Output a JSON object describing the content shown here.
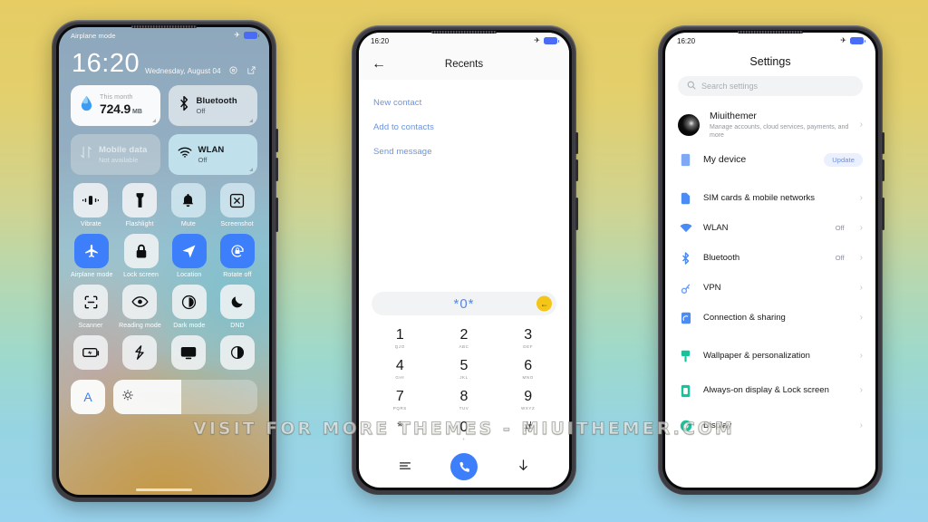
{
  "background": {
    "top_color": "#e6cc63",
    "bottom_color": "#9ad3ee"
  },
  "watermark": {
    "text": "VISIT FOR MORE THEMES - MIUITHEMER.COM"
  },
  "accent": {
    "blue": "#3d7efb",
    "link_blue": "#6a92e0",
    "yellow": "#f5c518",
    "green": "#19c39a"
  },
  "phone1": {
    "name": "control-center",
    "statusbar": {
      "left_label": "Airplane mode",
      "airplane_icon": "airplane-icon",
      "battery_icon": "battery-icon"
    },
    "clock": {
      "time": "16:20",
      "date": "Wednesday, August 04"
    },
    "header_icons": [
      "settings-gear-icon",
      "edit-icon"
    ],
    "big_tiles": [
      {
        "kind": "data",
        "top": "This month",
        "value": "724.9",
        "unit": "MB",
        "icon": "water-drop-icon",
        "style": "white"
      },
      {
        "kind": "toggle",
        "title": "Bluetooth",
        "status": "Off",
        "icon": "bluetooth-icon",
        "style": "light"
      },
      {
        "kind": "toggle",
        "title": "Mobile data",
        "status": "Not available",
        "icon": "mobile-data-icon",
        "style": "dim"
      },
      {
        "kind": "toggle",
        "title": "WLAN",
        "status": "Off",
        "icon": "wifi-icon",
        "style": "cyan"
      }
    ],
    "tiles": [
      {
        "label": "Vibrate",
        "icon": "vibrate-icon",
        "state": "off"
      },
      {
        "label": "Flashlight",
        "icon": "flashlight-icon",
        "state": "off"
      },
      {
        "label": "Mute",
        "icon": "bell-icon",
        "state": "offc"
      },
      {
        "label": "Screenshot",
        "icon": "screenshot-icon",
        "state": "offc"
      },
      {
        "label": "Airplane mode",
        "icon": "airplane-icon",
        "state": "on"
      },
      {
        "label": "Lock screen",
        "icon": "lock-icon",
        "state": "off"
      },
      {
        "label": "Location",
        "icon": "location-icon",
        "state": "on"
      },
      {
        "label": "Rotate off",
        "icon": "rotate-lock-icon",
        "state": "on"
      },
      {
        "label": "Scanner",
        "icon": "scanner-icon",
        "state": "off"
      },
      {
        "label": "Reading mode",
        "icon": "eye-icon",
        "state": "off"
      },
      {
        "label": "Dark mode",
        "icon": "contrast-icon",
        "state": "off"
      },
      {
        "label": "DND",
        "icon": "moon-icon",
        "state": "off"
      },
      {
        "label": "",
        "icon": "battery-saver-icon",
        "state": "off"
      },
      {
        "label": "",
        "icon": "sync-icon",
        "state": "off"
      },
      {
        "label": "",
        "icon": "cast-icon",
        "state": "off"
      },
      {
        "label": "",
        "icon": "brightness-icon",
        "state": "off"
      }
    ],
    "brightness": {
      "auto_label": "A",
      "slider_icon": "sun-icon",
      "fill_percent": "47"
    }
  },
  "phone2": {
    "name": "dialer",
    "statusbar": {
      "time": "16:20",
      "airplane_icon": "airplane-icon",
      "battery_icon": "battery-icon"
    },
    "header": {
      "back_icon": "back-arrow-icon",
      "title": "Recents"
    },
    "actions": [
      "New contact",
      "Add to contacts",
      "Send message"
    ],
    "dial_input": {
      "value": "*0*",
      "delete_icon": "backspace-icon"
    },
    "keys": [
      {
        "digit": "1",
        "letters": "QJO"
      },
      {
        "digit": "2",
        "letters": "ABC"
      },
      {
        "digit": "3",
        "letters": "DEF"
      },
      {
        "digit": "4",
        "letters": "GHI"
      },
      {
        "digit": "5",
        "letters": "JKL"
      },
      {
        "digit": "6",
        "letters": "MNO"
      },
      {
        "digit": "7",
        "letters": "PQRS"
      },
      {
        "digit": "8",
        "letters": "TUV"
      },
      {
        "digit": "9",
        "letters": "WXYZ"
      },
      {
        "digit": "*",
        "letters": ""
      },
      {
        "digit": "0",
        "letters": "+"
      },
      {
        "digit": "#",
        "letters": ""
      }
    ],
    "bottom": {
      "menu_icon": "menu-icon",
      "call_icon": "phone-icon",
      "hide_icon": "down-arrow-icon"
    }
  },
  "phone3": {
    "name": "settings",
    "statusbar": {
      "time": "16:20",
      "airplane_icon": "airplane-icon",
      "battery_icon": "battery-icon"
    },
    "title": "Settings",
    "search": {
      "placeholder": "Search settings",
      "icon": "search-icon"
    },
    "account": {
      "name": "Miuithemer",
      "subtitle": "Manage accounts, cloud services, payments, and more",
      "avatar": "avatar"
    },
    "device": {
      "label": "My device",
      "badge": "Update",
      "icon": "device-icon"
    },
    "groups": [
      {
        "items": [
          {
            "label": "SIM cards & mobile networks",
            "value": "",
            "icon": "sim-icon",
            "color": "#4b8bf4"
          },
          {
            "label": "WLAN",
            "value": "Off",
            "icon": "wifi-icon",
            "color": "#4b8bf4"
          },
          {
            "label": "Bluetooth",
            "value": "Off",
            "icon": "bluetooth-icon",
            "color": "#4b8bf4"
          },
          {
            "label": "VPN",
            "value": "",
            "icon": "vpn-key-icon",
            "color": "#6aa0f7"
          },
          {
            "label": "Connection & sharing",
            "value": "",
            "icon": "sharing-icon",
            "color": "#4b8bf4"
          }
        ]
      },
      {
        "items": [
          {
            "label": "Wallpaper & personalization",
            "value": "",
            "icon": "wallpaper-icon",
            "color": "#19c39a"
          },
          {
            "label": "Always-on display & Lock screen",
            "value": "",
            "icon": "aod-icon",
            "color": "#19c39a"
          },
          {
            "label": "Display",
            "value": "",
            "icon": "display-icon",
            "color": "#19c39a"
          }
        ]
      }
    ]
  }
}
